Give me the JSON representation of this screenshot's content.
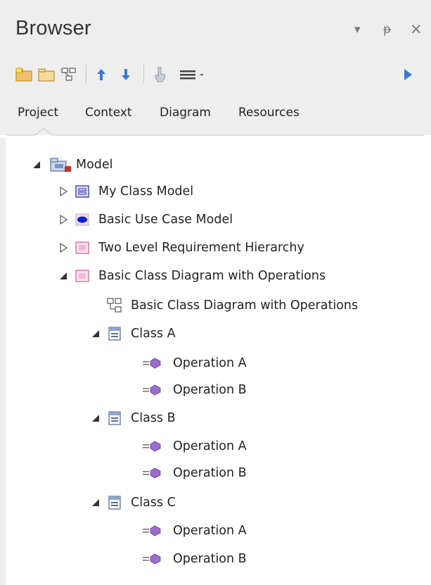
{
  "panel": {
    "title": "Browser",
    "controls": {
      "dropdown": "▾",
      "pin": "ᵽ",
      "close": "×"
    }
  },
  "toolbar": {
    "buttons": [
      "new-package-icon",
      "new-folder-icon",
      "new-diagram-icon",
      "move-up-icon",
      "move-down-icon",
      "locate-icon",
      "menu-icon",
      "expand-icon"
    ]
  },
  "tabs": [
    {
      "label": "Project",
      "active": true
    },
    {
      "label": "Context"
    },
    {
      "label": "Diagram"
    },
    {
      "label": "Resources"
    }
  ],
  "tree": {
    "root": {
      "label": "Model",
      "expanded": true
    },
    "packages": [
      {
        "label": "My Class Model",
        "expanded": false,
        "icon": "class-model-icon"
      },
      {
        "label": "Basic Use Case Model",
        "expanded": false,
        "icon": "use-case-model-icon"
      },
      {
        "label": "Two Level Requirement Hierarchy",
        "expanded": false,
        "icon": "package-icon"
      },
      {
        "label": "Basic Class Diagram with Operations",
        "expanded": true,
        "icon": "package-icon"
      }
    ],
    "diagram": {
      "label": "Basic Class Diagram with Operations"
    },
    "classes": [
      {
        "label": "Class A",
        "operations": [
          "Operation A",
          "Operation B"
        ]
      },
      {
        "label": "Class B",
        "operations": [
          "Operation A",
          "Operation B"
        ]
      },
      {
        "label": "Class C",
        "operations": [
          "Operation A",
          "Operation B"
        ]
      }
    ]
  },
  "colors": {
    "header_bg": "#eeeeee",
    "accent_blue": "#3a78d6",
    "folder_orange": "#f2c26b",
    "package_pink": "#f5b7d4",
    "operation_purple": "#9b6cc9"
  }
}
